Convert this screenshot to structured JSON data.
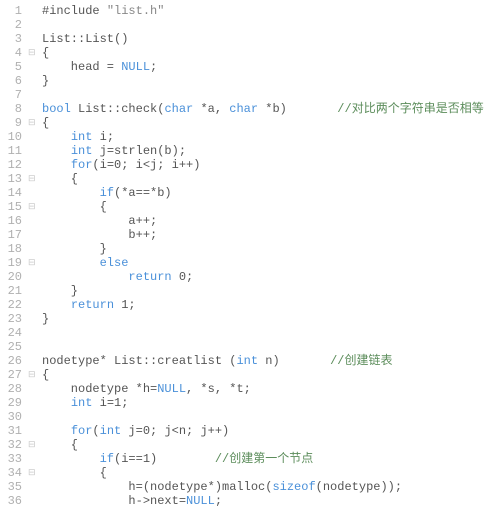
{
  "font_family": "Consolas",
  "code_lines": [
    {
      "n": 1,
      "fold": "",
      "tokens": [
        [
          "#include ",
          ""
        ],
        [
          "\"list.h\"",
          "str"
        ]
      ]
    },
    {
      "n": 2,
      "fold": "",
      "tokens": [
        [
          "",
          ""
        ]
      ]
    },
    {
      "n": 3,
      "fold": "",
      "tokens": [
        [
          "List::List()",
          ""
        ]
      ]
    },
    {
      "n": 4,
      "fold": "⊟",
      "tokens": [
        [
          "{",
          ""
        ]
      ]
    },
    {
      "n": 5,
      "fold": "",
      "tokens": [
        [
          "    head = ",
          ""
        ],
        [
          "NULL",
          "kw"
        ],
        [
          ";",
          ""
        ]
      ]
    },
    {
      "n": 6,
      "fold": "",
      "tokens": [
        [
          "}",
          ""
        ]
      ]
    },
    {
      "n": 7,
      "fold": "",
      "tokens": [
        [
          "",
          ""
        ]
      ]
    },
    {
      "n": 8,
      "fold": "",
      "tokens": [
        [
          "bool",
          "kw"
        ],
        [
          " List::check(",
          ""
        ],
        [
          "char",
          "kw"
        ],
        [
          " *a, ",
          ""
        ],
        [
          "char",
          "kw"
        ],
        [
          " *b)       ",
          ""
        ],
        [
          "//对比两个字符串是否相等",
          "cmt"
        ]
      ]
    },
    {
      "n": 9,
      "fold": "⊟",
      "tokens": [
        [
          "{",
          ""
        ]
      ]
    },
    {
      "n": 10,
      "fold": "",
      "tokens": [
        [
          "    ",
          ""
        ],
        [
          "int",
          "kw"
        ],
        [
          " i;",
          ""
        ]
      ]
    },
    {
      "n": 11,
      "fold": "",
      "tokens": [
        [
          "    ",
          ""
        ],
        [
          "int",
          "kw"
        ],
        [
          " j=strlen(b);",
          ""
        ]
      ]
    },
    {
      "n": 12,
      "fold": "",
      "tokens": [
        [
          "    ",
          ""
        ],
        [
          "for",
          "kw"
        ],
        [
          "(i=0; i<j; i++)",
          ""
        ]
      ]
    },
    {
      "n": 13,
      "fold": "⊟",
      "tokens": [
        [
          "    {",
          ""
        ]
      ]
    },
    {
      "n": 14,
      "fold": "",
      "tokens": [
        [
          "        ",
          ""
        ],
        [
          "if",
          "kw"
        ],
        [
          "(*a==*b)",
          ""
        ]
      ]
    },
    {
      "n": 15,
      "fold": "⊟",
      "tokens": [
        [
          "        {",
          ""
        ]
      ]
    },
    {
      "n": 16,
      "fold": "",
      "tokens": [
        [
          "            a++;",
          ""
        ]
      ]
    },
    {
      "n": 17,
      "fold": "",
      "tokens": [
        [
          "            b++;",
          ""
        ]
      ]
    },
    {
      "n": 18,
      "fold": "",
      "tokens": [
        [
          "        }",
          ""
        ]
      ]
    },
    {
      "n": 19,
      "fold": "⊟",
      "tokens": [
        [
          "        ",
          ""
        ],
        [
          "else",
          "kw"
        ]
      ]
    },
    {
      "n": 20,
      "fold": "",
      "tokens": [
        [
          "            ",
          ""
        ],
        [
          "return",
          "kw"
        ],
        [
          " 0;",
          ""
        ]
      ]
    },
    {
      "n": 21,
      "fold": "",
      "tokens": [
        [
          "    }",
          ""
        ]
      ]
    },
    {
      "n": 22,
      "fold": "",
      "tokens": [
        [
          "    ",
          ""
        ],
        [
          "return",
          "kw"
        ],
        [
          " 1;",
          ""
        ]
      ]
    },
    {
      "n": 23,
      "fold": "",
      "tokens": [
        [
          "}",
          ""
        ]
      ]
    },
    {
      "n": 24,
      "fold": "",
      "tokens": [
        [
          "",
          ""
        ]
      ]
    },
    {
      "n": 25,
      "fold": "",
      "tokens": [
        [
          "",
          ""
        ]
      ]
    },
    {
      "n": 26,
      "fold": "",
      "tokens": [
        [
          "nodetype* List::creatlist (",
          ""
        ],
        [
          "int",
          "kw"
        ],
        [
          " n)       ",
          ""
        ],
        [
          "//创建链表",
          "cmt"
        ]
      ]
    },
    {
      "n": 27,
      "fold": "⊟",
      "tokens": [
        [
          "{",
          ""
        ]
      ]
    },
    {
      "n": 28,
      "fold": "",
      "tokens": [
        [
          "    nodetype *h=",
          ""
        ],
        [
          "NULL",
          "kw"
        ],
        [
          ", *s, *t;",
          ""
        ]
      ]
    },
    {
      "n": 29,
      "fold": "",
      "tokens": [
        [
          "    ",
          ""
        ],
        [
          "int",
          "kw"
        ],
        [
          " i=1;",
          ""
        ]
      ]
    },
    {
      "n": 30,
      "fold": "",
      "tokens": [
        [
          "",
          ""
        ]
      ]
    },
    {
      "n": 31,
      "fold": "",
      "tokens": [
        [
          "    ",
          ""
        ],
        [
          "for",
          "kw"
        ],
        [
          "(",
          ""
        ],
        [
          "int",
          "kw"
        ],
        [
          " j=0; j<n; j++)",
          ""
        ]
      ]
    },
    {
      "n": 32,
      "fold": "⊟",
      "tokens": [
        [
          "    {",
          ""
        ]
      ]
    },
    {
      "n": 33,
      "fold": "",
      "tokens": [
        [
          "        ",
          ""
        ],
        [
          "if",
          "kw"
        ],
        [
          "(i==1)        ",
          ""
        ],
        [
          "//创建第一个节点",
          "cmt"
        ]
      ]
    },
    {
      "n": 34,
      "fold": "⊟",
      "tokens": [
        [
          "        {",
          ""
        ]
      ]
    },
    {
      "n": 35,
      "fold": "",
      "tokens": [
        [
          "            h=(nodetype*)malloc(",
          ""
        ],
        [
          "sizeof",
          "kw"
        ],
        [
          "(nodetype));",
          ""
        ]
      ]
    },
    {
      "n": 36,
      "fold": "",
      "tokens": [
        [
          "            h->next=",
          ""
        ],
        [
          "NULL",
          "kw"
        ],
        [
          ";",
          ""
        ]
      ]
    }
  ]
}
